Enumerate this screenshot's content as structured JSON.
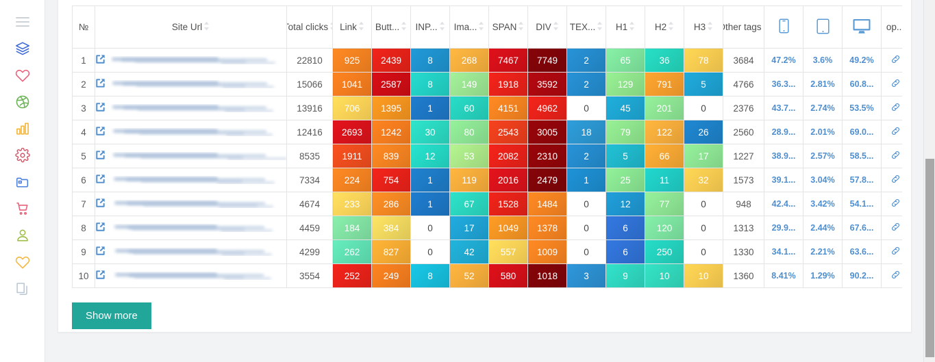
{
  "sidebar": {
    "items": [
      {
        "name": "menu-toggle",
        "icon": "hamburger-icon",
        "color": "#c9ced3"
      },
      {
        "name": "layers",
        "icon": "layers-icon",
        "color": "#3f6ad8"
      },
      {
        "name": "favorites",
        "icon": "heart-icon",
        "color": "#e8607a"
      },
      {
        "name": "dribbble",
        "icon": "dribbble-icon",
        "color": "#69b354"
      },
      {
        "name": "analytics",
        "icon": "bar-chart-icon",
        "color": "#f5b63c"
      },
      {
        "name": "settings",
        "icon": "gear-icon",
        "color": "#d0596a"
      },
      {
        "name": "folders",
        "icon": "folder-icon",
        "color": "#4a7fe0"
      },
      {
        "name": "shop",
        "icon": "cart-icon",
        "color": "#e8607a"
      },
      {
        "name": "account",
        "icon": "user-icon",
        "color": "#9dbd47"
      },
      {
        "name": "likes",
        "icon": "heart-icon",
        "color": "#f5b63c"
      },
      {
        "name": "documents",
        "icon": "files-icon",
        "color": "#b9c7d4"
      }
    ]
  },
  "table": {
    "columns": [
      {
        "key": "no",
        "label": "№",
        "sortable": false,
        "type": "num"
      },
      {
        "key": "url",
        "label": "Site Url",
        "sortable": true,
        "type": "url"
      },
      {
        "key": "total",
        "label": "Total clicks",
        "sortable": true,
        "type": "plain"
      },
      {
        "key": "link",
        "label": "Link",
        "sortable": true,
        "type": "heat"
      },
      {
        "key": "button",
        "label": "Butt...",
        "sortable": true,
        "type": "heat"
      },
      {
        "key": "input",
        "label": "INP...",
        "sortable": true,
        "type": "heat"
      },
      {
        "key": "image",
        "label": "Ima...",
        "sortable": true,
        "type": "heat"
      },
      {
        "key": "span",
        "label": "SPAN",
        "sortable": true,
        "type": "heat"
      },
      {
        "key": "div",
        "label": "DIV",
        "sortable": true,
        "type": "heat"
      },
      {
        "key": "text",
        "label": "TEX...",
        "sortable": true,
        "type": "heat"
      },
      {
        "key": "h1",
        "label": "H1",
        "sortable": true,
        "type": "heat"
      },
      {
        "key": "h2",
        "label": "H2",
        "sortable": true,
        "type": "heat"
      },
      {
        "key": "h3",
        "label": "H3",
        "sortable": true,
        "type": "heat"
      },
      {
        "key": "other",
        "label": "Other tags",
        "sortable": true,
        "type": "plain"
      },
      {
        "key": "mobile",
        "label": "mobile-icon",
        "sortable": false,
        "type": "pct"
      },
      {
        "key": "tablet",
        "label": "tablet-icon",
        "sortable": false,
        "type": "pct"
      },
      {
        "key": "desktop",
        "label": "desktop-icon",
        "sortable": false,
        "type": "pct"
      },
      {
        "key": "op",
        "label": "op...",
        "sortable": false,
        "type": "op"
      }
    ],
    "rows": [
      {
        "no": "1",
        "total": "22810",
        "link": "925",
        "button": "2439",
        "input": "8",
        "image": "268",
        "span": "7467",
        "div": "7749",
        "text": "2",
        "h1": "65",
        "h2": "36",
        "h3": "78",
        "other": "3684",
        "mobile": "47.2%",
        "tablet": "3.6%",
        "desktop": "49.2%"
      },
      {
        "no": "2",
        "total": "15066",
        "link": "1041",
        "button": "2587",
        "input": "8",
        "image": "149",
        "span": "1918",
        "div": "3592",
        "text": "2",
        "h1": "129",
        "h2": "791",
        "h3": "5",
        "other": "4766",
        "mobile": "36.3...",
        "tablet": "2.81%",
        "desktop": "60.8..."
      },
      {
        "no": "3",
        "total": "13916",
        "link": "706",
        "button": "1395",
        "input": "1",
        "image": "60",
        "span": "4151",
        "div": "4962",
        "text": "0",
        "h1": "45",
        "h2": "201",
        "h3": "0",
        "other": "2376",
        "mobile": "43.7...",
        "tablet": "2.74%",
        "desktop": "53.5%"
      },
      {
        "no": "4",
        "total": "12416",
        "link": "2693",
        "button": "1242",
        "input": "30",
        "image": "80",
        "span": "2543",
        "div": "3005",
        "text": "18",
        "h1": "79",
        "h2": "122",
        "h3": "26",
        "other": "2560",
        "mobile": "28.9...",
        "tablet": "2.01%",
        "desktop": "69.0..."
      },
      {
        "no": "5",
        "total": "8535",
        "link": "1911",
        "button": "839",
        "input": "12",
        "image": "53",
        "span": "2082",
        "div": "2310",
        "text": "2",
        "h1": "5",
        "h2": "66",
        "h3": "17",
        "other": "1227",
        "mobile": "38.9...",
        "tablet": "2.57%",
        "desktop": "58.5..."
      },
      {
        "no": "6",
        "total": "7334",
        "link": "224",
        "button": "754",
        "input": "1",
        "image": "119",
        "span": "2016",
        "div": "2479",
        "text": "1",
        "h1": "25",
        "h2": "11",
        "h3": "32",
        "other": "1573",
        "mobile": "39.1...",
        "tablet": "3.04%",
        "desktop": "57.8..."
      },
      {
        "no": "7",
        "total": "4674",
        "link": "233",
        "button": "286",
        "input": "1",
        "image": "67",
        "span": "1528",
        "div": "1484",
        "text": "0",
        "h1": "12",
        "h2": "77",
        "h3": "0",
        "other": "948",
        "mobile": "42.4...",
        "tablet": "3.42%",
        "desktop": "54.1..."
      },
      {
        "no": "8",
        "total": "4459",
        "link": "184",
        "button": "384",
        "input": "0",
        "image": "17",
        "span": "1049",
        "div": "1378",
        "text": "0",
        "h1": "6",
        "h2": "120",
        "h3": "0",
        "other": "1313",
        "mobile": "29.9...",
        "tablet": "2.44%",
        "desktop": "67.6..."
      },
      {
        "no": "9",
        "total": "4299",
        "link": "262",
        "button": "827",
        "input": "0",
        "image": "42",
        "span": "557",
        "div": "1009",
        "text": "0",
        "h1": "6",
        "h2": "250",
        "h3": "0",
        "other": "1330",
        "mobile": "34.1...",
        "tablet": "2.21%",
        "desktop": "63.6..."
      },
      {
        "no": "10",
        "total": "3554",
        "link": "252",
        "button": "249",
        "input": "8",
        "image": "52",
        "span": "580",
        "div": "1018",
        "text": "3",
        "h1": "9",
        "h2": "10",
        "h3": "10",
        "other": "1360",
        "mobile": "8.41%",
        "tablet": "1.29%",
        "desktop": "90.2..."
      }
    ],
    "cell_colors": {
      "link": [
        "#ef8020",
        "#ef7a1e",
        "#f6cf55",
        "#d4121a",
        "#e84b1d",
        "#ef8020",
        "#f5d058",
        "#7fdea0",
        "#5edcb0",
        "#e32119"
      ],
      "button": [
        "#e02118",
        "#c90c14",
        "#ee911f",
        "#f07a1e",
        "#ef8020",
        "#e32119",
        "#ef8522",
        "#ecd45d",
        "#f1a832",
        "#ee7a1e"
      ],
      "input": [
        "#1e8fc9",
        "#22ccc0",
        "#1d74c0",
        "#2ad4bd",
        "#23d3c0",
        "#1d78c1",
        "#1d74c0",
        "#ffffff",
        "#ffffff",
        "#16b9d6"
      ],
      "image": [
        "#f0ab3c",
        "#98e08f",
        "#25cdb9",
        "#8ae090",
        "#a8e385",
        "#f0a93a",
        "#2ad2bb",
        "#1e9fcf",
        "#1fa7cd",
        "#f0a93a"
      ],
      "span": [
        "#cf0f18",
        "#e32119",
        "#ef8020",
        "#e53d1c",
        "#e32119",
        "#d4121a",
        "#e02118",
        "#ee9122",
        "#f4cf55",
        "#cf0f18"
      ],
      "div": [
        "#7c0408",
        "#a8080f",
        "#e32119",
        "#8e0509",
        "#8e0509",
        "#7c0408",
        "#ef8020",
        "#ef8020",
        "#ef8020",
        "#7c0408"
      ],
      "text": [
        "#2488c8",
        "#2488c8",
        "#ffffff",
        "#2b92cb",
        "#2488c8",
        "#1c88c8",
        "#ffffff",
        "#ffffff",
        "#ffffff",
        "#2b8ccb"
      ],
      "h1": [
        "#7ce09a",
        "#8de089",
        "#1da2cd",
        "#8ce08a",
        "#1fb3c6",
        "#86e08e",
        "#1e93cb",
        "#2f6fd0",
        "#2f6fd0",
        "#2ed2bb"
      ],
      "h2": [
        "#24cfb7",
        "#f09a2c",
        "#8ae090",
        "#f0a93a",
        "#f0a332",
        "#1fc8c0",
        "#8ae090",
        "#7adf9d",
        "#23cdb9",
        "#30d3b7"
      ],
      "h3": [
        "#f3c84f",
        "#1d9ecd",
        "#ffffff",
        "#1d7ec3",
        "#8ae090",
        "#f3c84f",
        "#ffffff",
        "#ffffff",
        "#ffffff",
        "#f3c84f"
      ]
    }
  },
  "actions": {
    "show_more_label": "Show more"
  },
  "theme": {
    "accent": "#22a699",
    "link_blue": "#4f8fd0",
    "icon_blue": "#5b9bd5"
  }
}
